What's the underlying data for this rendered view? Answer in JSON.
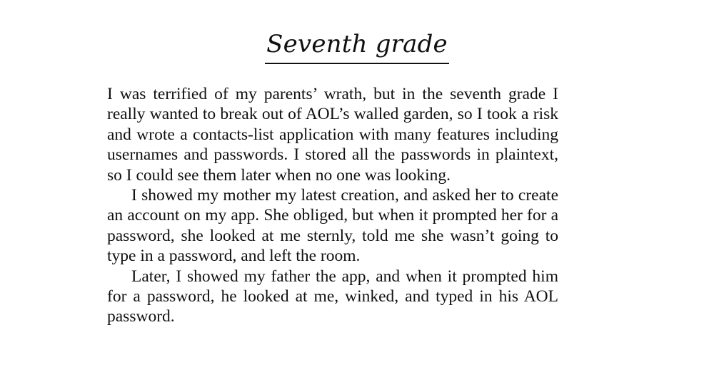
{
  "document": {
    "title": "Seventh grade",
    "paragraphs": [
      "I was terrified of my parents’ wrath, but in the seventh grade I really wanted to break out of AOL’s walled garden, so I took a risk and wrote a contacts-list application with many features including usernames and passwords. I stored all the passwords in plaintext, so I could see them later when no one was looking.",
      "I showed my mother my latest creation, and asked her to create an account on my app. She obliged, but when it prompted her for a password, she looked at me sternly, told me she wasn’t going to type in a password, and left the room.",
      "Later, I showed my father the app, and when it prompted him for a password, he looked at me, winked, and typed in his AOL password."
    ]
  }
}
